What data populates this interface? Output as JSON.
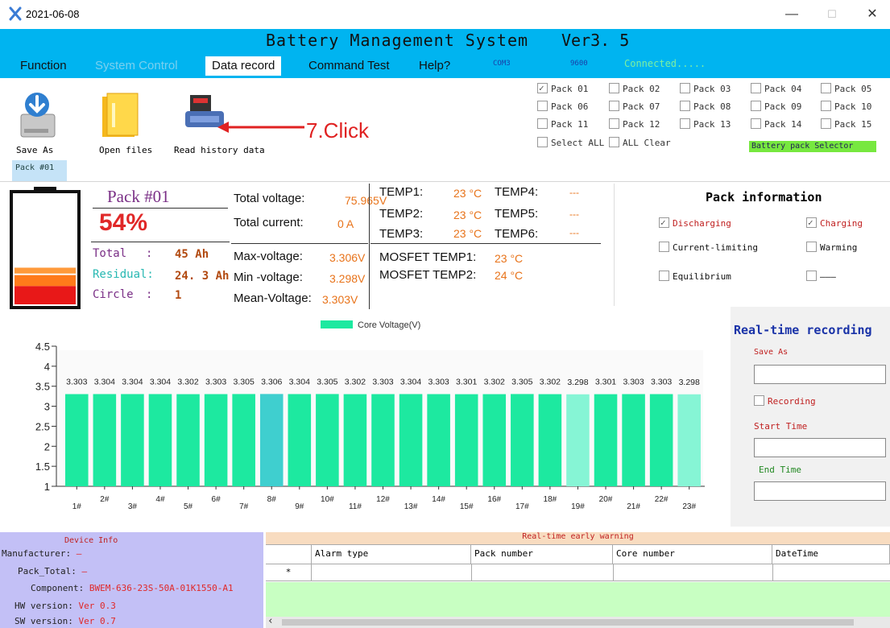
{
  "window": {
    "title": "2021-06-08",
    "minimize": "—",
    "maximize": "☐",
    "close": "✕"
  },
  "app": {
    "title": "Battery Management System",
    "version": "Ver3. 5"
  },
  "menu": {
    "items": [
      {
        "label": "Function",
        "state": "normal"
      },
      {
        "label": "System Control",
        "state": "disabled"
      },
      {
        "label": "Data record",
        "state": "active"
      },
      {
        "label": "Command Test",
        "state": "normal"
      },
      {
        "label": "Help?",
        "state": "normal"
      }
    ],
    "port": "COM3",
    "baud": "9600",
    "connection": "Connected....."
  },
  "toolbar": {
    "save_as": "Save As",
    "open_files": "Open files",
    "read_history": "Read history data",
    "callout": "7.Click"
  },
  "pack_selector": {
    "packs": [
      {
        "label": "Pack 01",
        "checked": true
      },
      {
        "label": "Pack 02",
        "checked": false
      },
      {
        "label": "Pack 03",
        "checked": false
      },
      {
        "label": "Pack 04",
        "checked": false
      },
      {
        "label": "Pack 05",
        "checked": false
      },
      {
        "label": "Pack 06",
        "checked": false
      },
      {
        "label": "Pack 07",
        "checked": false
      },
      {
        "label": "Pack 08",
        "checked": false
      },
      {
        "label": "Pack 09",
        "checked": false
      },
      {
        "label": "Pack 10",
        "checked": false
      },
      {
        "label": "Pack 11",
        "checked": false
      },
      {
        "label": "Pack 12",
        "checked": false
      },
      {
        "label": "Pack 13",
        "checked": false
      },
      {
        "label": "Pack 14",
        "checked": false
      },
      {
        "label": "Pack 15",
        "checked": false
      }
    ],
    "select_all": "Select ALL",
    "all_clear": "ALL Clear",
    "label": "Battery pack Selector"
  },
  "pack_tab": "Pack #01",
  "pack": {
    "name": "Pack #01",
    "soc": "54%",
    "soc_fraction": 0.54,
    "total_label": "Total",
    "total_sep": ":",
    "total_value": "45 Ah",
    "residual_label": "Residual:",
    "residual_value": "24. 3 Ah",
    "circle_label": "Circle",
    "circle_sep": ":",
    "circle_value": "1"
  },
  "measurements": {
    "total_voltage_label": "Total voltage:",
    "total_voltage": "75.965V",
    "total_current_label": "Total current:",
    "total_current": "0 A",
    "max_voltage_label": "Max-voltage:",
    "max_voltage": "3.306V",
    "min_voltage_label": "Min -voltage:",
    "min_voltage": "3.298V",
    "mean_voltage_label": "Mean-Voltage:",
    "mean_voltage": "3.303V"
  },
  "temps": {
    "temp1_label": "TEMP1:",
    "temp1": "23 °C",
    "temp2_label": "TEMP2:",
    "temp2": "23 °C",
    "temp3_label": "TEMP3:",
    "temp3": "23 °C",
    "temp4_label": "TEMP4:",
    "temp4": "---",
    "temp5_label": "TEMP5:",
    "temp5": "---",
    "temp6_label": "TEMP6:",
    "temp6": "---",
    "mosfet1_label": "MOSFET TEMP1:",
    "mosfet1": "23 °C",
    "mosfet2_label": "MOSFET TEMP2:",
    "mosfet2": "24 °C"
  },
  "pack_info": {
    "title": "Pack information",
    "discharging": "Discharging",
    "charging": "Charging",
    "current_limiting": "Current-limiting",
    "warming": "Warming",
    "equilibrium": "Equilibrium",
    "blank": "———"
  },
  "chart_data": {
    "type": "bar",
    "legend": "Core Voltage(V)",
    "legend_position": "top-center",
    "categories": [
      "1#",
      "2#",
      "3#",
      "4#",
      "5#",
      "6#",
      "7#",
      "8#",
      "9#",
      "10#",
      "11#",
      "12#",
      "13#",
      "14#",
      "15#",
      "16#",
      "17#",
      "18#",
      "19#",
      "20#",
      "21#",
      "22#",
      "23#"
    ],
    "values": [
      3.303,
      3.304,
      3.304,
      3.304,
      3.302,
      3.303,
      3.305,
      3.306,
      3.304,
      3.305,
      3.302,
      3.303,
      3.304,
      3.303,
      3.301,
      3.302,
      3.305,
      3.302,
      3.298,
      3.301,
      3.303,
      3.303,
      3.298
    ],
    "value_labels": [
      "3.303",
      "3.304",
      "3.304",
      "3.304",
      "3.302",
      "3.303",
      "3.305",
      "3.306",
      "3.304",
      "3.305",
      "3.302",
      "3.303",
      "3.304",
      "3.303",
      "3.301",
      "3.302",
      "3.305",
      "3.302",
      "3.298",
      "3.301",
      "3.303",
      "3.303",
      "3.298"
    ],
    "y_ticks": [
      "1",
      "1.5",
      "2",
      "2.5",
      "3",
      "3.5",
      "4",
      "4.5"
    ],
    "ylim": [
      1,
      4.5
    ],
    "grid": false,
    "colors": {
      "normal": "#1de9a0",
      "max": "#3fcfcf",
      "min": "#86f5d5"
    }
  },
  "realtime": {
    "title": "Real-time recording",
    "save_as": "Save As",
    "recording": "Recording",
    "start_time": "Start Time",
    "end_time": "End Time"
  },
  "device_info": {
    "title": "Device Info",
    "manufacturer_label": "Manufacturer:",
    "manufacturer": "—",
    "pack_total_label": "Pack_Total:",
    "pack_total": "—",
    "component_label": "Component:",
    "component": "BWEM-636-23S-50A-01K1550-A1",
    "hw_label": "HW version:",
    "hw": "Ver 0.3",
    "sw_label": "SW version:",
    "sw": "Ver 0.7"
  },
  "warning": {
    "title": "Real-time early warning",
    "columns": [
      "Alarm type",
      "Pack number",
      "Core number",
      "DateTime"
    ],
    "new_row_marker": "*",
    "scroll_left": "‹"
  }
}
